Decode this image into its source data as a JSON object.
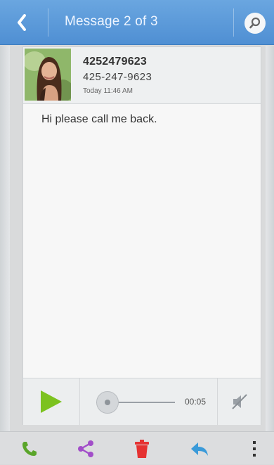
{
  "header": {
    "title": "Message 2 of 3"
  },
  "contact": {
    "name": "4252479623",
    "number": "425-247-9623",
    "time": "Today 11:46 AM"
  },
  "message": {
    "text": "Hi please call me back."
  },
  "player": {
    "duration": "00:05",
    "progress": 0
  },
  "colors": {
    "topbar": "#5b9ad9",
    "play": "#7cc21f",
    "call": "#5aa52a",
    "share": "#a24ec9",
    "delete": "#e53232",
    "reply": "#3a9ad9"
  },
  "icons": {
    "back": "chevron-left-icon",
    "search": "search-icon",
    "play": "play-icon",
    "mute": "speaker-muted-icon",
    "call": "phone-icon",
    "share": "share-icon",
    "delete": "trash-icon",
    "reply": "reply-icon",
    "overflow": "more-vertical-icon"
  }
}
